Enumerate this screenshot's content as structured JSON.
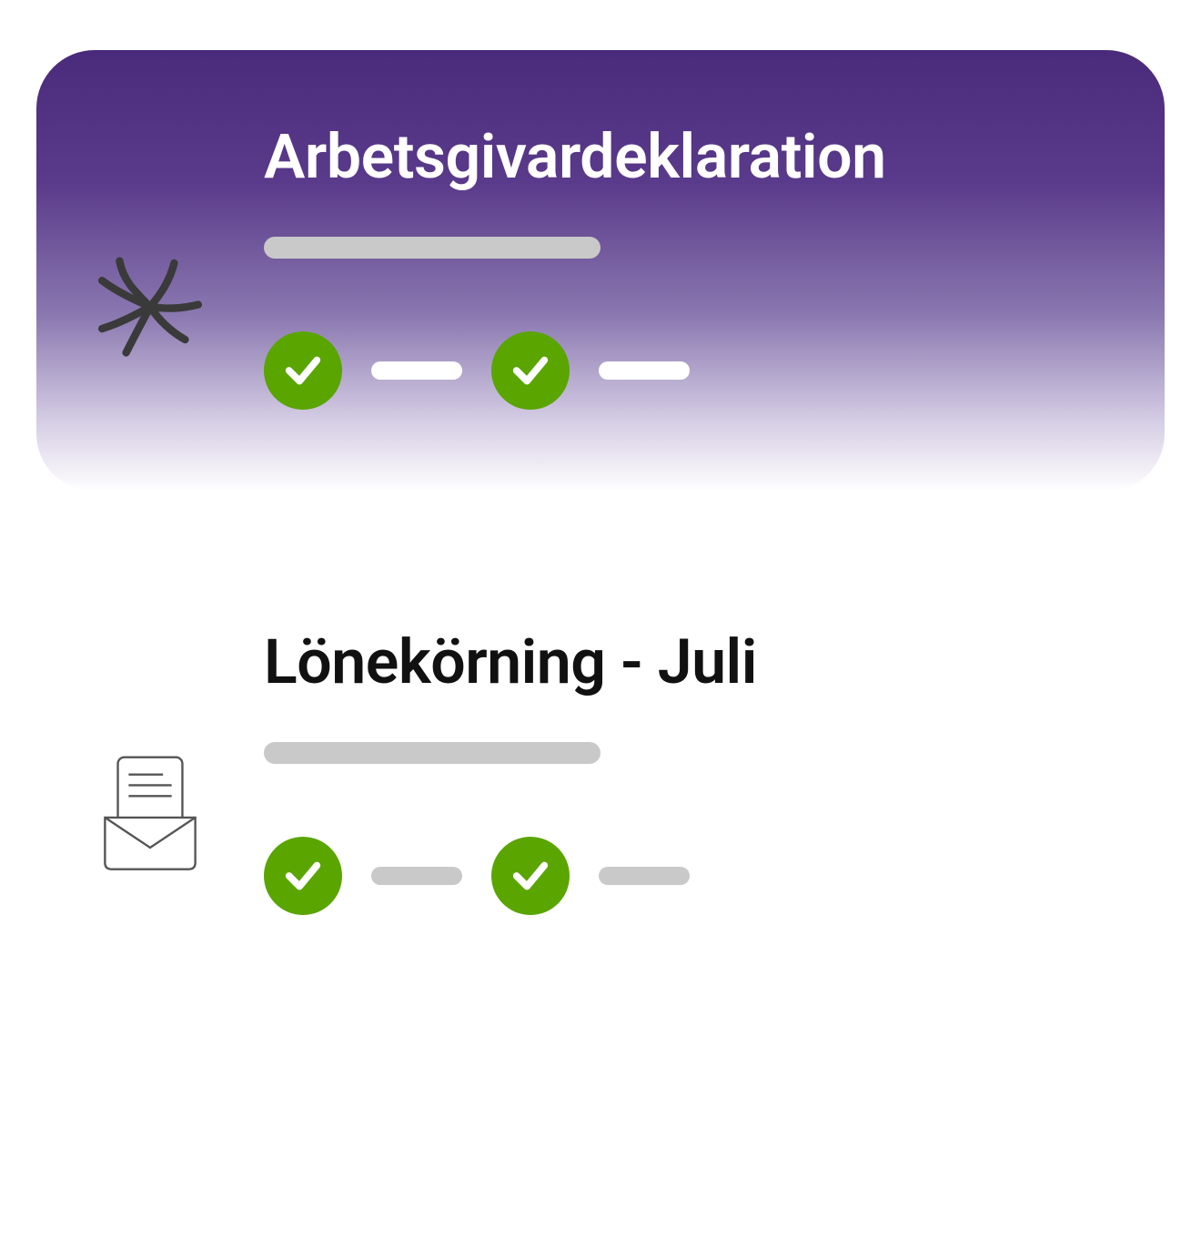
{
  "cards": [
    {
      "title": "Arbetsgivardeklaration",
      "variant": "purple",
      "icon": "swirl",
      "steps": [
        {
          "done": true
        },
        {
          "done": true
        }
      ]
    },
    {
      "title": "Lönekörning - Juli",
      "variant": "white",
      "icon": "envelope",
      "steps": [
        {
          "done": true
        },
        {
          "done": true
        }
      ]
    }
  ],
  "colors": {
    "purple_top": "#4a2a7a",
    "check_green": "#5aa500",
    "placeholder_grey": "#c9c9c9"
  }
}
